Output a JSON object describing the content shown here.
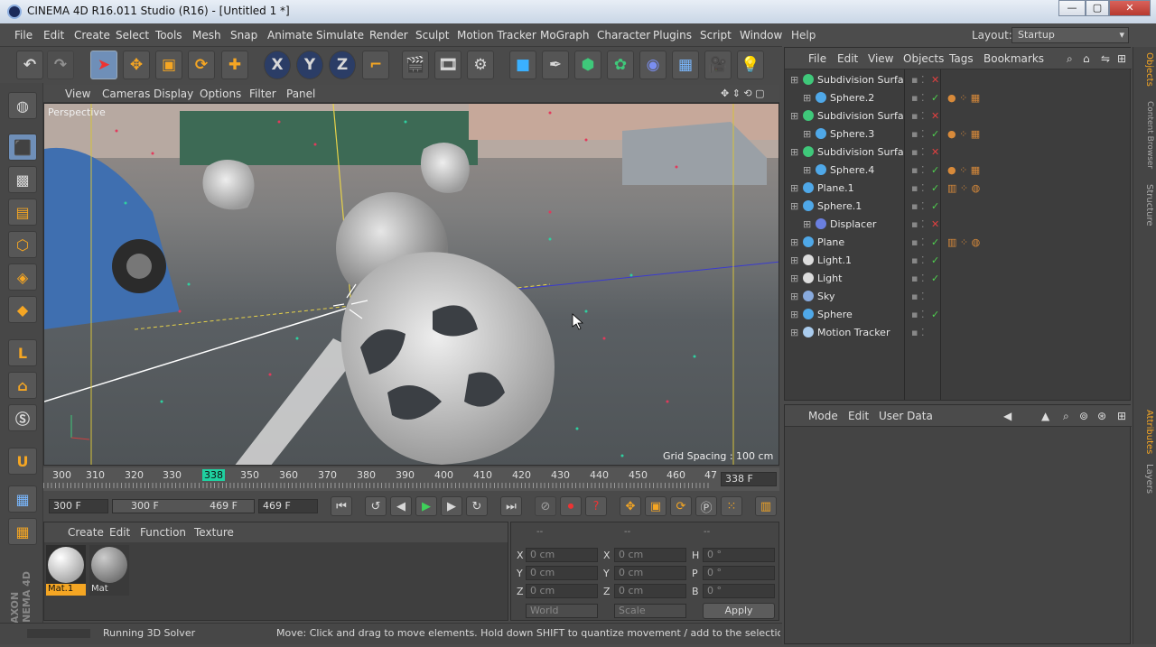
{
  "window": {
    "title": "CINEMA 4D R16.011 Studio (R16) - [Untitled 1 *]",
    "minimize": "—",
    "maximize": "▢",
    "close": "✕"
  },
  "menu": [
    "File",
    "Edit",
    "Create",
    "Select",
    "Tools",
    "Mesh",
    "Snap",
    "Animate",
    "Simulate",
    "Render",
    "Sculpt",
    "Motion Tracker",
    "MoGraph",
    "Character",
    "Plugins",
    "Script",
    "Window",
    "Help"
  ],
  "layout": {
    "label": "Layout:",
    "value": "Startup"
  },
  "toolbar": {
    "x_label": "X",
    "y_label": "Y",
    "z_label": "Z"
  },
  "viewport": {
    "menu": [
      "View",
      "Cameras",
      "Display",
      "Options",
      "Filter",
      "Panel"
    ],
    "label": "Perspective",
    "grid_spacing": "Grid Spacing : 100 cm"
  },
  "timeline": {
    "ticks": [
      "300",
      "310",
      "320",
      "330",
      "338",
      "350",
      "360",
      "370",
      "380",
      "390",
      "400",
      "410",
      "420",
      "430",
      "440",
      "450",
      "460",
      "47"
    ],
    "current_frame": "338 F",
    "start": "300 F",
    "range_start": "300 F",
    "range_end": "469 F",
    "end": "469 F"
  },
  "materials": {
    "menu": [
      "Create",
      "Edit",
      "Function",
      "Texture"
    ],
    "items": [
      {
        "name": "Mat.1"
      },
      {
        "name": "Mat"
      }
    ]
  },
  "coords": {
    "header": [
      "--",
      "--",
      "--"
    ],
    "rows": [
      {
        "a": "X",
        "av": "0 cm",
        "b": "X",
        "bv": "0 cm",
        "c": "H",
        "cv": "0 °"
      },
      {
        "a": "Y",
        "av": "0 cm",
        "b": "Y",
        "bv": "0 cm",
        "c": "P",
        "cv": "0 °"
      },
      {
        "a": "Z",
        "av": "0 cm",
        "b": "Z",
        "bv": "0 cm",
        "c": "B",
        "cv": "0 °"
      }
    ],
    "world": "World",
    "scale": "Scale",
    "apply": "Apply"
  },
  "status": {
    "left": "Running 3D Solver",
    "right": "Move: Click and drag to move elements. Hold down SHIFT to quantize movement / add to the selection in po"
  },
  "objects": {
    "menu": [
      "File",
      "Edit",
      "View",
      "Objects",
      "Tags",
      "Bookmarks"
    ],
    "rows": [
      {
        "name": "Subdivision Surfac",
        "indent": 0,
        "color": "#3fc87a",
        "tag": "x"
      },
      {
        "name": "Sphere.2",
        "indent": 1,
        "color": "#4fa8e8",
        "tag": "c"
      },
      {
        "name": "Subdivision Surfac",
        "indent": 0,
        "color": "#3fc87a",
        "tag": "x"
      },
      {
        "name": "Sphere.3",
        "indent": 1,
        "color": "#4fa8e8",
        "tag": "c"
      },
      {
        "name": "Subdivision Surfac",
        "indent": 0,
        "color": "#3fc87a",
        "tag": "x"
      },
      {
        "name": "Sphere.4",
        "indent": 1,
        "color": "#4fa8e8",
        "tag": "c"
      },
      {
        "name": "Plane.1",
        "indent": 0,
        "color": "#4fa8e8",
        "tag": "c"
      },
      {
        "name": "Sphere.1",
        "indent": 0,
        "color": "#4fa8e8",
        "tag": "c"
      },
      {
        "name": "Displacer",
        "indent": 1,
        "color": "#6a7fe0",
        "tag": "x"
      },
      {
        "name": "Plane",
        "indent": 0,
        "color": "#4fa8e8",
        "tag": "c"
      },
      {
        "name": "Light.1",
        "indent": 0,
        "color": "#dddddd",
        "tag": "c"
      },
      {
        "name": "Light",
        "indent": 0,
        "color": "#dddddd",
        "tag": "c"
      },
      {
        "name": "Sky",
        "indent": 0,
        "color": "#88aadd",
        "tag": ""
      },
      {
        "name": "Sphere",
        "indent": 0,
        "color": "#4fa8e8",
        "tag": "c"
      },
      {
        "name": "Motion Tracker",
        "indent": 0,
        "color": "#aaccee",
        "tag": ""
      }
    ]
  },
  "attributes": {
    "menu": [
      "Mode",
      "Edit",
      "User Data"
    ]
  },
  "side_tabs": [
    "Objects",
    "Content Browser",
    "Structure",
    "Attributes",
    "Layers"
  ],
  "brand": "MAXON CINEMA 4D"
}
